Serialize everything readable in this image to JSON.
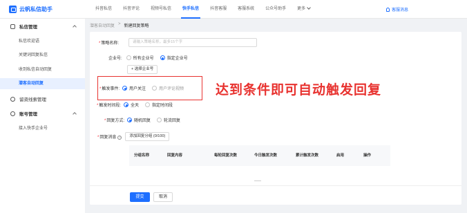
{
  "app": {
    "title": "云帆私信助手"
  },
  "nav": {
    "items": [
      "抖音私信",
      "抖音评论",
      "视频号私信",
      "快手私信",
      "抖音客服",
      "客服系统",
      "公众号助手",
      "更多"
    ],
    "active": "快手私信",
    "service": "客服消息"
  },
  "sidebar": {
    "group1": "私信管理",
    "items": [
      "私信欢迎语",
      "关键词回复私信",
      "收到私信自动回复",
      "潜客自动回复"
    ],
    "active": "潜客自动回复",
    "group2": "留资线索管理",
    "group3": "账号管理",
    "item5": "接入快手企业号"
  },
  "breadcrumb": {
    "parent": "潜客自动回复",
    "sep": ">",
    "current": "新建回复策略"
  },
  "form": {
    "name_label": "策略名称:",
    "name_placeholder": "请输入策略名称，最多15个字",
    "account_label": "企业号:",
    "account_opts": [
      "所有企业号",
      "指定企业号"
    ],
    "add_account": "+ 选择企业号",
    "trigger_label": "触发事件:",
    "trigger_opts": [
      "用户关注",
      "用户评论视频"
    ],
    "time_label": "触发时间段:",
    "time_opts": [
      "全天",
      "指定时间段"
    ],
    "mode_label": "回复方式:",
    "mode_opts": [
      "随机回复",
      "轮流回复"
    ],
    "msg_label": "回复消息",
    "msg_add": "添加回复分组 (0/100)"
  },
  "table": {
    "headers": [
      "分组名称",
      "回复内容",
      "每轮回复次数",
      "今日触发次数",
      "累计触发次数",
      "启用",
      "操作"
    ]
  },
  "annotation": "达到条件即可自动触发回复",
  "footer": {
    "submit": "提交",
    "cancel": "取消"
  },
  "colors": {
    "accent": "#1e6fff",
    "annotation": "#e8322f"
  }
}
